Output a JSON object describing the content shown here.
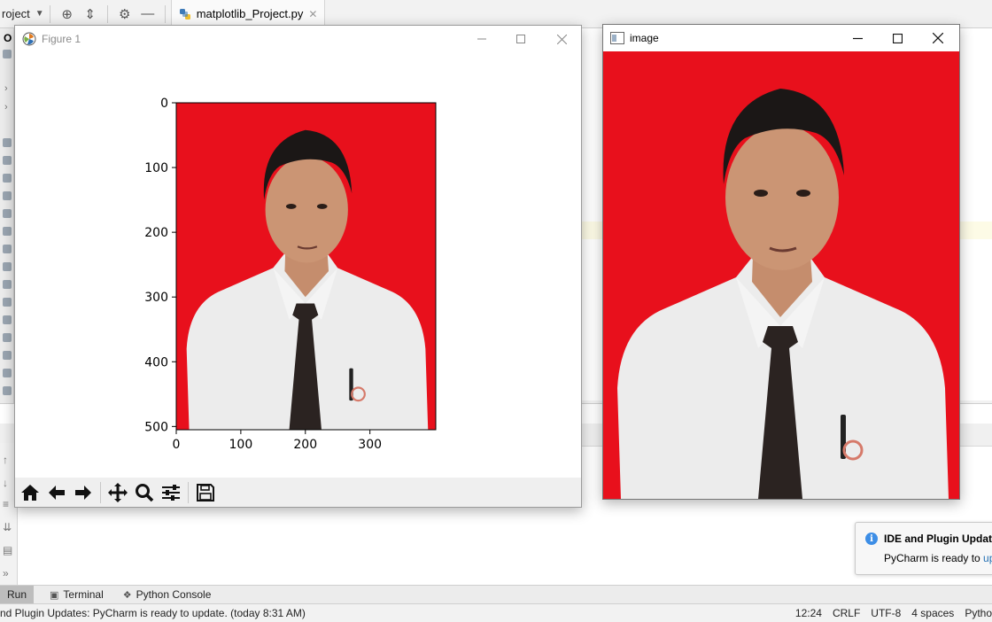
{
  "ide": {
    "project_label": "roject",
    "editor_tab_label": "matplotlib_Project.py",
    "panel_tag": "O"
  },
  "figure_window": {
    "title": "Figure 1",
    "axes": {
      "y_ticks": [
        "0",
        "100",
        "200",
        "300",
        "400",
        "500"
      ],
      "x_ticks": [
        "0",
        "100",
        "200",
        "300"
      ],
      "y_tick_values": [
        0,
        100,
        200,
        300,
        400,
        500
      ],
      "x_tick_values": [
        0,
        100,
        200,
        300
      ],
      "x_range": [
        0,
        402
      ],
      "y_range": [
        0,
        505
      ]
    },
    "toolbar": [
      "home-icon",
      "back-icon",
      "forward-icon",
      "pan-icon",
      "zoom-icon",
      "configure-subplots-icon",
      "save-icon"
    ]
  },
  "image_window": {
    "title": "image"
  },
  "bottom_tabs": [
    {
      "label": "Run"
    },
    {
      "label": "Terminal"
    },
    {
      "label": "Python Console"
    }
  ],
  "status_bar": {
    "message": "nd Plugin Updates: PyCharm is ready to update. (today 8:31 AM)",
    "position": "12:24",
    "line_sep": "CRLF",
    "encoding": "UTF-8",
    "indent": "4 spaces",
    "interpreter": "Pytho"
  },
  "notification": {
    "title": "IDE and Plugin Update",
    "body": "PyCharm is ready to ",
    "link": "up"
  },
  "colors": {
    "background_red": "#e8101c",
    "shirt": "#ececec",
    "tie": "#2b2321"
  }
}
